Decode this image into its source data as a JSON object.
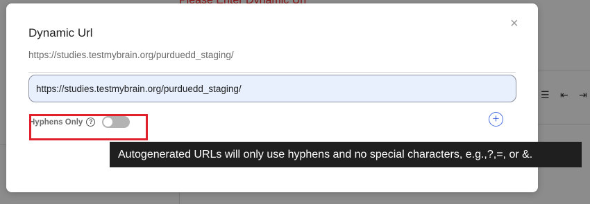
{
  "background": {
    "error_text": "Please Enter Dynamic Url"
  },
  "modal": {
    "title": "Dynamic Url",
    "close_label": "×",
    "url_preview": "https://studies.testmybrain.org/purduedd_staging/",
    "url_input_value": "https://studies.testmybrain.org/purduedd_staging/",
    "hyphens": {
      "label": "Hyphens Only",
      "help_glyph": "?",
      "enabled": false
    },
    "add_glyph": "+",
    "tooltip": "Autogenerated URLs will only use hyphens and no special characters, e.g.,?,=, or &."
  },
  "colors": {
    "highlight": "#e0202a",
    "accent": "#4a6fe0",
    "input_bg": "#e8f0fe"
  },
  "icons": [
    "close-icon",
    "help-icon",
    "add-circle-icon"
  ]
}
